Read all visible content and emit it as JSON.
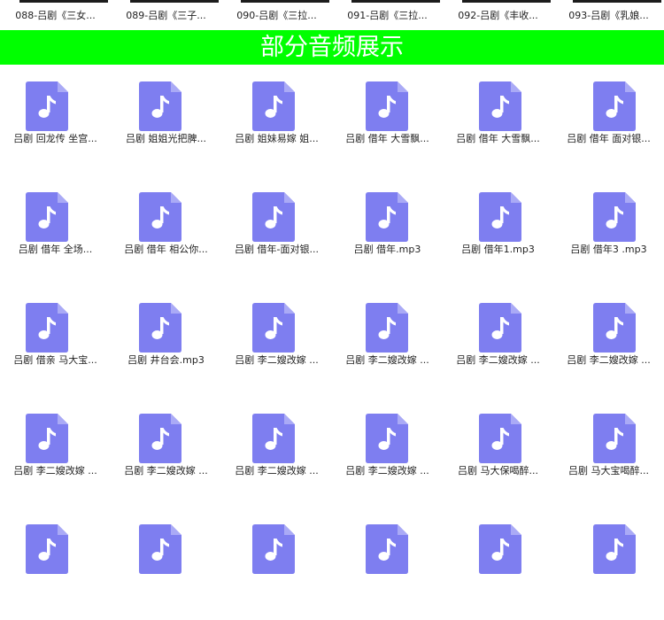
{
  "colors": {
    "banner": "#00ff00",
    "file_icon": "#7e7ef0",
    "file_icon_fold": "#aaaaf6"
  },
  "videos": [
    {
      "label": "088-吕剧《三女..."
    },
    {
      "label": "089-吕剧《三子..."
    },
    {
      "label": "090-吕剧《三拉..."
    },
    {
      "label": "091-吕剧《三拉..."
    },
    {
      "label": "092-吕剧《丰收..."
    },
    {
      "label": "093-吕剧《乳娘..."
    }
  ],
  "banner": {
    "title": "部分音频展示"
  },
  "audio_icon": "music-note-file-icon",
  "audio_files": [
    {
      "label": "吕剧 回龙传 坐宫..."
    },
    {
      "label": "吕剧 姐姐光把脾..."
    },
    {
      "label": "吕剧 姐妹易嫁 姐..."
    },
    {
      "label": "吕剧 借年 大雪飘..."
    },
    {
      "label": "吕剧 借年 大雪飘..."
    },
    {
      "label": "吕剧 借年 面对银..."
    },
    {
      "label": "吕剧 借年 全场..."
    },
    {
      "label": "吕剧 借年 相公你..."
    },
    {
      "label": "吕剧 借年-面对银..."
    },
    {
      "label": "吕剧 借年.mp3"
    },
    {
      "label": "吕剧 借年1.mp3"
    },
    {
      "label": "吕剧 借年3 .mp3"
    },
    {
      "label": "吕剧 借亲 马大宝..."
    },
    {
      "label": "吕剧 井台会.mp3"
    },
    {
      "label": "吕剧 李二嫂改嫁 ..."
    },
    {
      "label": "吕剧 李二嫂改嫁 ..."
    },
    {
      "label": "吕剧 李二嫂改嫁 ..."
    },
    {
      "label": "吕剧 李二嫂改嫁 ..."
    },
    {
      "label": "吕剧 李二嫂改嫁 ..."
    },
    {
      "label": "吕剧 李二嫂改嫁 ..."
    },
    {
      "label": "吕剧 李二嫂改嫁 ..."
    },
    {
      "label": "吕剧 李二嫂改嫁 ..."
    },
    {
      "label": "吕剧 马大保喝醉..."
    },
    {
      "label": "吕剧 马大宝喝醉..."
    },
    {
      "label": ""
    },
    {
      "label": ""
    },
    {
      "label": ""
    },
    {
      "label": ""
    },
    {
      "label": ""
    },
    {
      "label": ""
    }
  ]
}
